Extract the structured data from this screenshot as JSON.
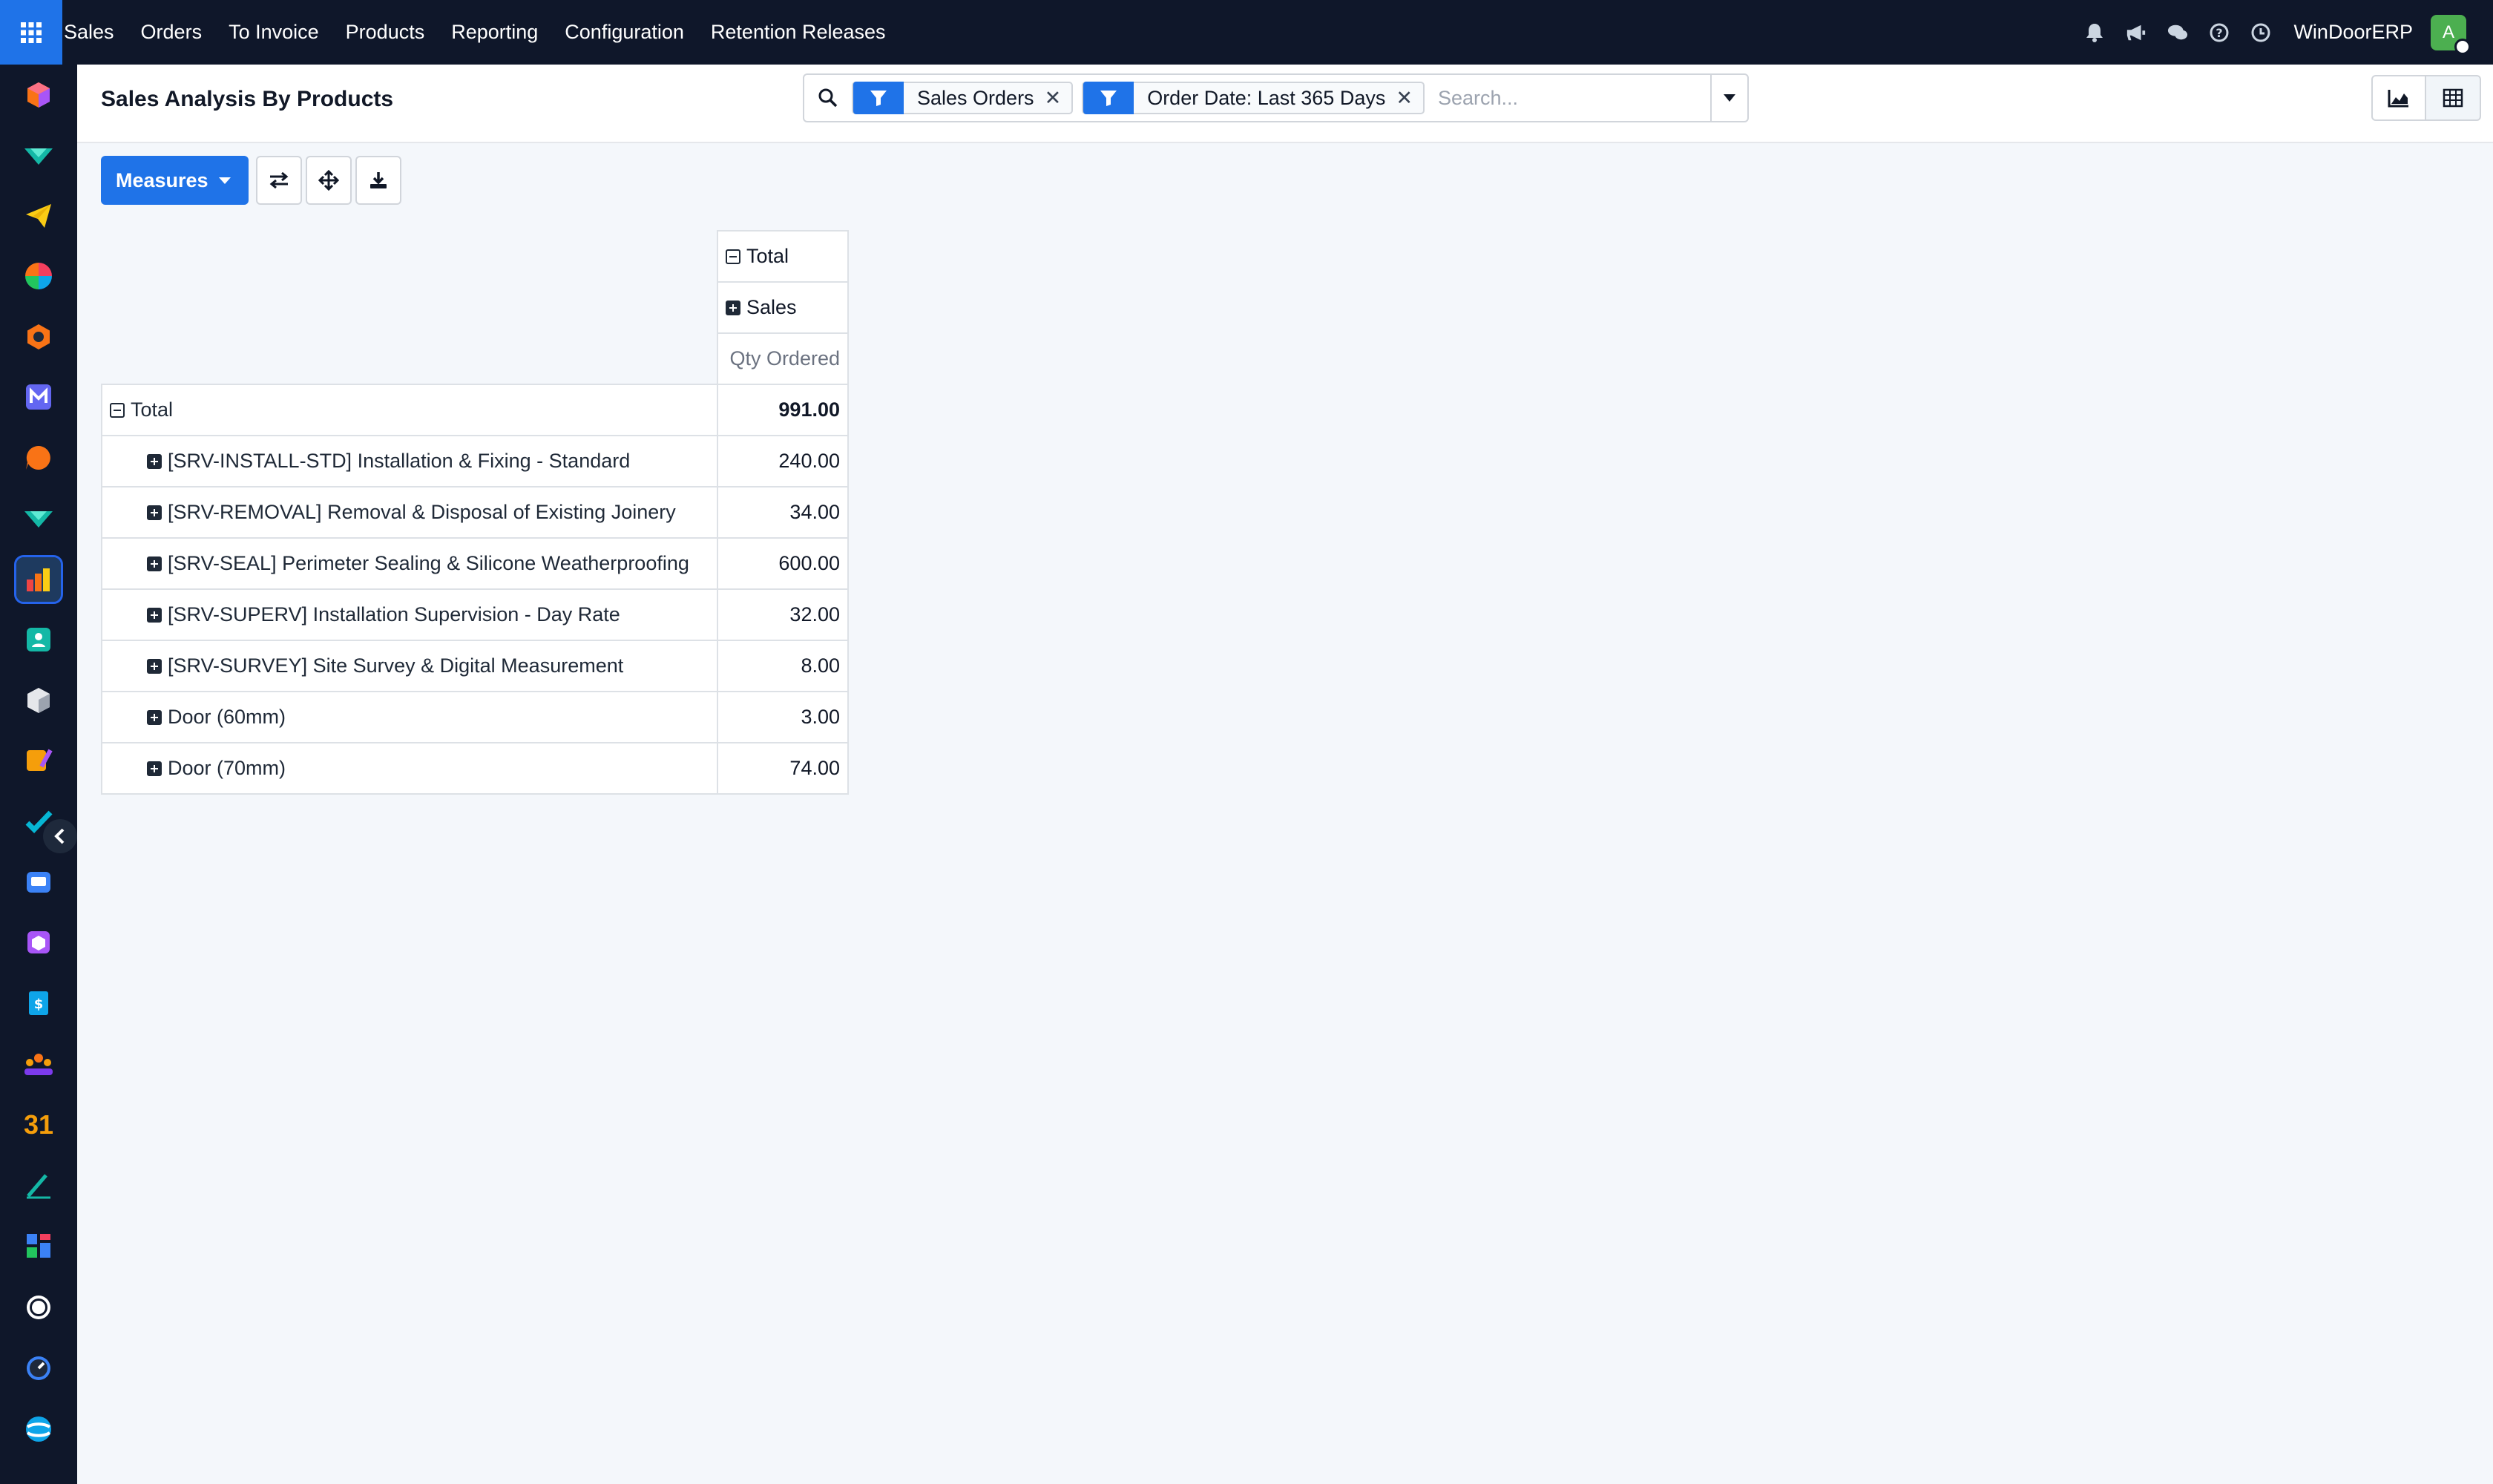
{
  "topbar": {
    "menu": [
      "Sales",
      "Orders",
      "To Invoice",
      "Products",
      "Reporting",
      "Configuration",
      "Retention Releases"
    ],
    "company": "WinDoorERP",
    "avatar_initial": "A",
    "icons": [
      "bell-icon",
      "megaphone-icon",
      "chat-icon",
      "help-icon",
      "clock-icon"
    ]
  },
  "sidebar": {
    "apps": [
      "cube-app-icon",
      "flow-app-icon",
      "send-app-icon",
      "pie-app-icon",
      "hexagon-app-icon",
      "mail-app-icon",
      "chat-bubble-app-icon",
      "flow2-app-icon",
      "sales-app-icon",
      "contacts-app-icon",
      "box-app-icon",
      "brush-app-icon",
      "check-app-icon",
      "helpdesk-app-icon",
      "package-app-icon",
      "invoice-app-icon",
      "team-app-icon",
      "calendar-app-icon",
      "sign-app-icon",
      "dashboard-app-icon",
      "whatsapp-app-icon",
      "clock-app-icon",
      "discuss-app-icon"
    ],
    "calendar_day": "31",
    "active_index": 8
  },
  "control_panel": {
    "title": "Sales Analysis By Products",
    "facets": [
      {
        "label": "Sales Orders"
      },
      {
        "label": "Order Date: Last 365 Days"
      }
    ],
    "search_placeholder": "Search..."
  },
  "toolbar": {
    "measures_label": "Measures"
  },
  "pivot": {
    "col_header_total": "Total",
    "col_header_group": "Sales",
    "measure": "Qty Ordered",
    "row_total_label": "Total",
    "row_total_value": "991.00",
    "rows": [
      {
        "label": "[SRV-INSTALL-STD] Installation & Fixing - Standard",
        "value": "240.00"
      },
      {
        "label": "[SRV-REMOVAL] Removal & Disposal of Existing Joinery",
        "value": "34.00"
      },
      {
        "label": "[SRV-SEAL] Perimeter Sealing & Silicone Weatherproofing",
        "value": "600.00"
      },
      {
        "label": "[SRV-SUPERV] Installation Supervision - Day Rate",
        "value": "32.00"
      },
      {
        "label": "[SRV-SURVEY] Site Survey & Digital Measurement",
        "value": "8.00"
      },
      {
        "label": "Door (60mm)",
        "value": "3.00"
      },
      {
        "label": "Door (70mm)",
        "value": "74.00"
      }
    ]
  }
}
